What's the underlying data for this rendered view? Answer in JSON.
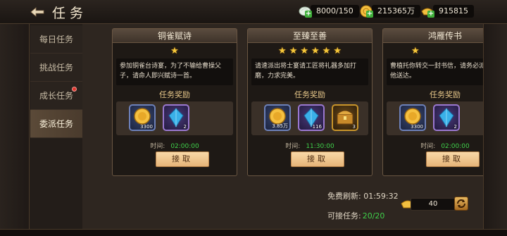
{
  "header": {
    "title": "任务",
    "back_icon": "back-arrow-icon"
  },
  "resources": [
    {
      "name": "stamina",
      "icon": "stamina-icon",
      "value": "8000/150",
      "has_add": true
    },
    {
      "name": "gold",
      "icon": "gold-coin-icon",
      "value": "215365万",
      "has_add": true
    },
    {
      "name": "ingot",
      "icon": "ingot-icon",
      "value": "915815",
      "has_add": true
    }
  ],
  "tabs": [
    {
      "label": "每日任务",
      "active": false,
      "dot": false
    },
    {
      "label": "挑战任务",
      "active": false,
      "dot": false
    },
    {
      "label": "成长任务",
      "active": false,
      "dot": true
    },
    {
      "label": "委派任务",
      "active": true,
      "dot": false
    }
  ],
  "cards": [
    {
      "title": "铜雀赋诗",
      "stars": 1,
      "desc": "参加铜雀台诗宴，为了不输给曹操父子，请命人即兴赋诗一首。",
      "reward_title": "任务奖励",
      "items": [
        {
          "type": "gold",
          "icon": "gold-coin-icon",
          "count": "3300"
        },
        {
          "type": "gem",
          "icon": "blue-gem-icon",
          "count": "2"
        }
      ],
      "time_label": "时间:",
      "time_value": "02:00:00",
      "button": "接取"
    },
    {
      "title": "至臻至善",
      "stars": 6,
      "desc": "请速派出将士宴请工匠将礼器多加打磨，力求完美。",
      "reward_title": "任务奖励",
      "items": [
        {
          "type": "gold",
          "icon": "gold-coin-icon",
          "count": "3.85万"
        },
        {
          "type": "gem",
          "icon": "blue-gem-icon",
          "count": "116"
        },
        {
          "type": "chest",
          "icon": "treasure-chest-icon",
          "count": "3"
        }
      ],
      "time_label": "时间:",
      "time_value": "11:30:00",
      "button": "接取"
    },
    {
      "title": "鸿雁传书",
      "stars": 1,
      "desc": "曹植托你转交一封书信，请务必派人帮他送达。",
      "reward_title": "任务奖励",
      "items": [
        {
          "type": "gold",
          "icon": "gold-coin-icon",
          "count": "3300"
        },
        {
          "type": "gem",
          "icon": "blue-gem-icon",
          "count": "2"
        }
      ],
      "time_label": "时间:",
      "time_value": "02:00:00",
      "button": "接取"
    }
  ],
  "footer": {
    "free_refresh_label": "免费刷新:",
    "free_refresh_time": "01:59:32",
    "available_label": "可接任务:",
    "available_value": "20/20",
    "refresh_cost": "40",
    "refresh_icon": "refresh-icon",
    "cost_icon": "gold-ingot-icon"
  },
  "colors": {
    "accent_green": "#3fd04a",
    "star_gold": "#f5c73a",
    "button_fill": "#e6b478"
  }
}
